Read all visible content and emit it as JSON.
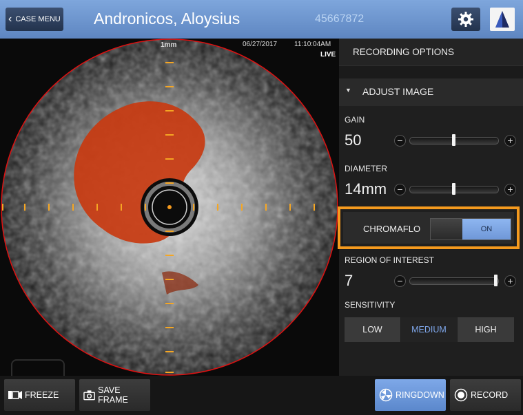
{
  "header": {
    "case_menu_label": "CASE MENU",
    "patient_name": "Andronicos, Aloysius",
    "patient_id": "45667872"
  },
  "image": {
    "scale": "1mm",
    "date": "06/27/2017",
    "time": "11:10:04AM",
    "mode": "LIVE"
  },
  "panel": {
    "recording_options": "RECORDING OPTIONS",
    "adjust_image": "ADJUST IMAGE",
    "gain": {
      "label": "GAIN",
      "value": "50",
      "level": 0.5
    },
    "diameter": {
      "label": "DIAMETER",
      "value": "14mm",
      "level": 0.5
    },
    "chromaflo": {
      "label": "CHROMAFLO",
      "state": "ON"
    },
    "roi": {
      "label": "REGION OF INTEREST",
      "value": "7",
      "level": 1.0
    },
    "sensitivity": {
      "label": "SENSITIVITY",
      "options": [
        "LOW",
        "MEDIUM",
        "HIGH"
      ],
      "selected": "MEDIUM"
    }
  },
  "bottom": {
    "freeze": "FREEZE",
    "save_frame": "SAVE FRAME",
    "ringdown": "RINGDOWN",
    "record": "RECORD"
  },
  "colors": {
    "header": "#6e96cf",
    "accent_blue": "#7ea6ea",
    "highlight": "#f59a1e",
    "flow_red": "#c83a10"
  }
}
